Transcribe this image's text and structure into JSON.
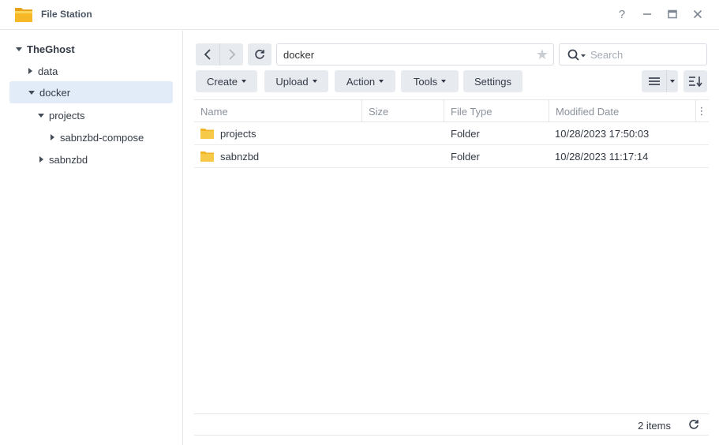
{
  "window": {
    "title": "File Station",
    "help_glyph": "?",
    "min_glyph": "—",
    "max_glyph": "□",
    "close_glyph": "✕"
  },
  "tree": {
    "root": "TheGhost",
    "items": [
      {
        "label": "data"
      },
      {
        "label": "docker"
      },
      {
        "label": "projects"
      },
      {
        "label": "sabnzbd-compose"
      },
      {
        "label": "sabnzbd"
      }
    ]
  },
  "toolbar": {
    "path_value": "docker",
    "search_placeholder": "Search",
    "create_label": "Create",
    "upload_label": "Upload",
    "action_label": "Action",
    "tools_label": "Tools",
    "settings_label": "Settings"
  },
  "grid": {
    "columns": [
      "Name",
      "Size",
      "File Type",
      "Modified Date"
    ],
    "rows": [
      {
        "name": "projects",
        "size": "",
        "type": "Folder",
        "modified": "10/28/2023 17:50:03"
      },
      {
        "name": "sabnzbd",
        "size": "",
        "type": "Folder",
        "modified": "10/28/2023 11:17:14"
      }
    ]
  },
  "status": {
    "count_label": "2 items"
  },
  "colors": {
    "selected_bg": "#e2ecf8",
    "button_bg": "#e7ebf0",
    "folder": "#f7c948"
  }
}
